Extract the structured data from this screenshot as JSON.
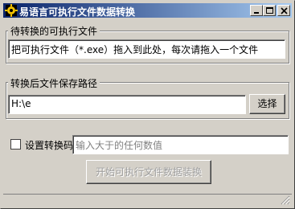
{
  "window": {
    "title": "易语言可执行文件数据转换"
  },
  "source_group": {
    "label": "待转换的可执行文件",
    "field_text": "把可执行文件（*.exe）拖入到此处，每次请拖入一个文件"
  },
  "output_group": {
    "label": "转换后文件保存路径",
    "path_value": "H:\\e",
    "select_label": "选择"
  },
  "options": {
    "checkbox_label": "设置转换码",
    "code_placeholder": "输入大于的任何数值",
    "checked": false
  },
  "actions": {
    "start_label": "开始可执行文件数据装换"
  }
}
